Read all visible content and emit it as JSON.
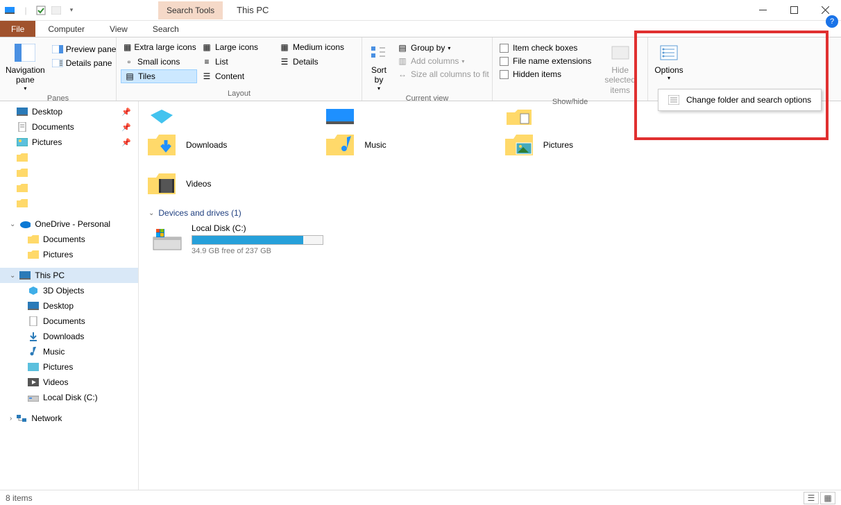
{
  "titlebar": {
    "search_tools": "Search Tools",
    "title": "This PC"
  },
  "tabs": {
    "file": "File",
    "computer": "Computer",
    "view": "View",
    "search": "Search"
  },
  "ribbon": {
    "panes": {
      "nav_pane": "Navigation pane",
      "preview": "Preview pane",
      "details": "Details pane",
      "label": "Panes"
    },
    "layout": {
      "extra_large": "Extra large icons",
      "large": "Large icons",
      "medium": "Medium icons",
      "small": "Small icons",
      "list": "List",
      "details": "Details",
      "tiles": "Tiles",
      "content": "Content",
      "label": "Layout"
    },
    "current_view": {
      "sort_by": "Sort by",
      "group_by": "Group by",
      "add_columns": "Add columns",
      "size_columns": "Size all columns to fit",
      "label": "Current view"
    },
    "show_hide": {
      "item_check": "Item check boxes",
      "file_ext": "File name extensions",
      "hidden": "Hidden items",
      "hide_selected": "Hide selected items",
      "label": "Show/hide"
    },
    "options": {
      "options": "Options",
      "change_folder": "Change folder and search options"
    }
  },
  "nav": {
    "desktop": "Desktop",
    "documents": "Documents",
    "pictures": "Pictures",
    "onedrive": "OneDrive - Personal",
    "this_pc": "This PC",
    "3d": "3D Objects",
    "downloads": "Downloads",
    "music": "Music",
    "videos": "Videos",
    "local_disk": "Local Disk (C:)",
    "network": "Network"
  },
  "folders": {
    "downloads": "Downloads",
    "music": "Music",
    "pictures": "Pictures",
    "videos": "Videos"
  },
  "section": {
    "devices": "Devices and drives (1)"
  },
  "drive": {
    "name": "Local Disk (C:)",
    "free": "34.9 GB free of 237 GB",
    "fill_pct": 85
  },
  "statusbar": {
    "count": "8 items"
  }
}
